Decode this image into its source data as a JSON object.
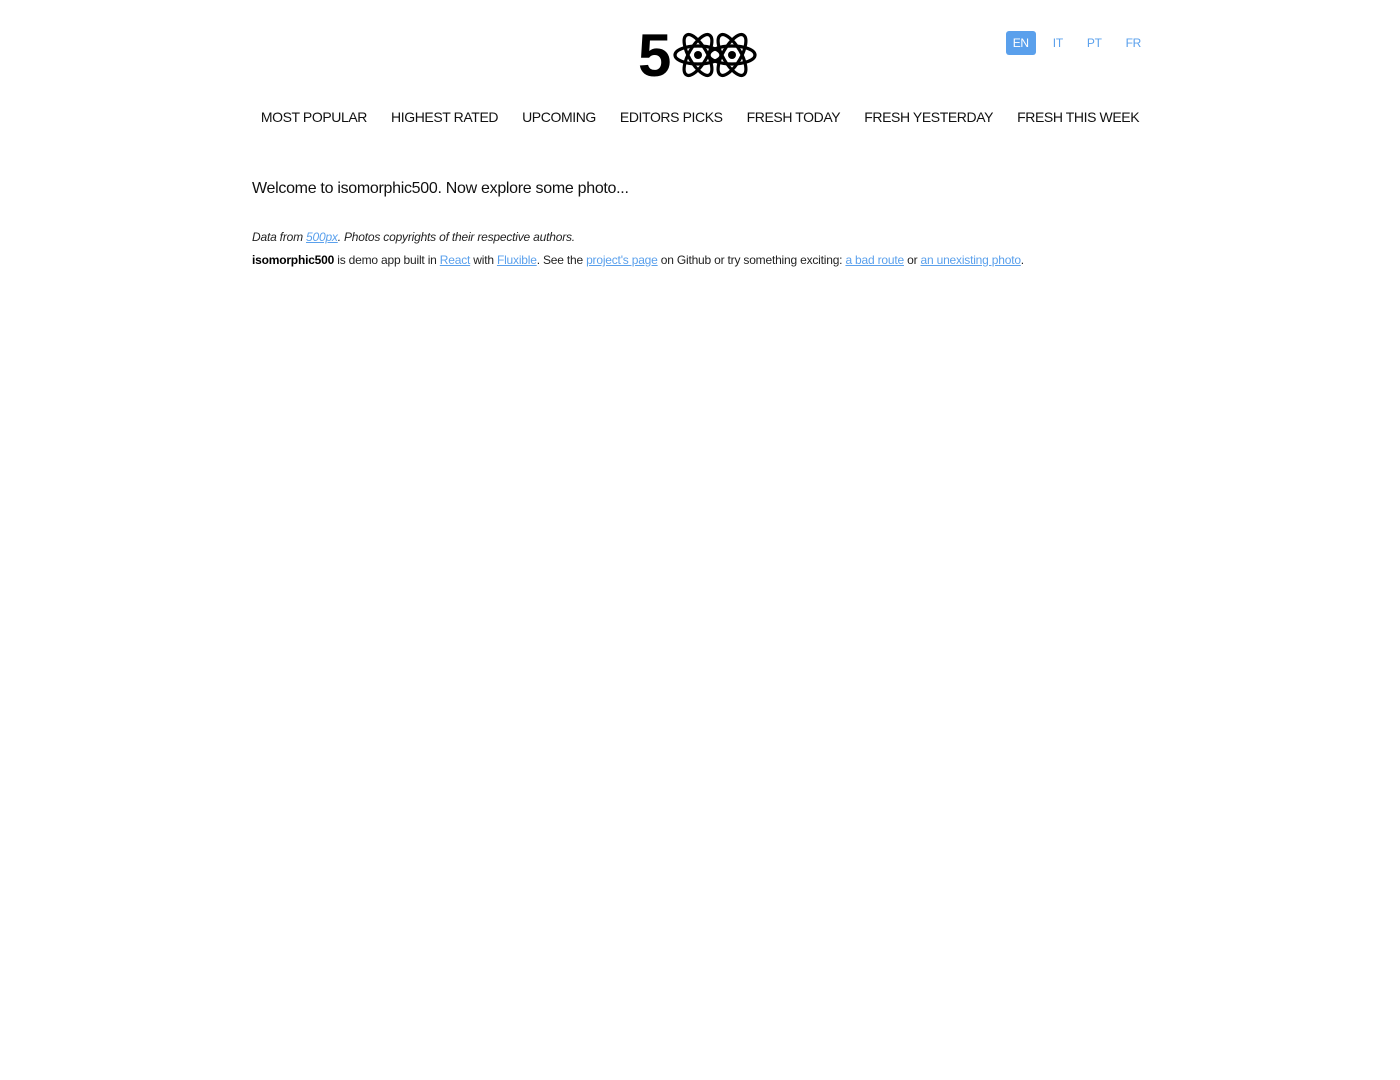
{
  "header": {
    "logo": {
      "text": "5",
      "icon": "react-atom-icon",
      "alt": "500"
    },
    "languages": [
      {
        "label": "EN",
        "active": true
      },
      {
        "label": "IT",
        "active": false
      },
      {
        "label": "PT",
        "active": false
      },
      {
        "label": "FR",
        "active": false
      }
    ]
  },
  "nav": {
    "items": [
      {
        "label": "MOST POPULAR"
      },
      {
        "label": "HIGHEST RATED"
      },
      {
        "label": "UPCOMING"
      },
      {
        "label": "EDITORS PICKS"
      },
      {
        "label": "FRESH TODAY"
      },
      {
        "label": "FRESH YESTERDAY"
      },
      {
        "label": "FRESH THIS WEEK"
      }
    ]
  },
  "main": {
    "welcome": "Welcome to isomorphic500. Now explore some photo...",
    "credits": {
      "prefix": "Data from ",
      "link": "500px",
      "suffix": ". Photos copyrights of their respective authors."
    },
    "about": {
      "app_name": "isomorphic500",
      "t1": " is demo app built in ",
      "react_link": "React",
      "t2": " with ",
      "fluxible_link": "Fluxible",
      "t3": ". See the ",
      "project_link": "project's page",
      "t4": " on Github or try something exciting: ",
      "bad_route_link": "a bad route",
      "t5": " or ",
      "unexisting_link": "an unexisting photo",
      "t6": "."
    }
  },
  "colors": {
    "accent": "#5aa0ec",
    "text": "#111111",
    "background": "#ffffff"
  }
}
